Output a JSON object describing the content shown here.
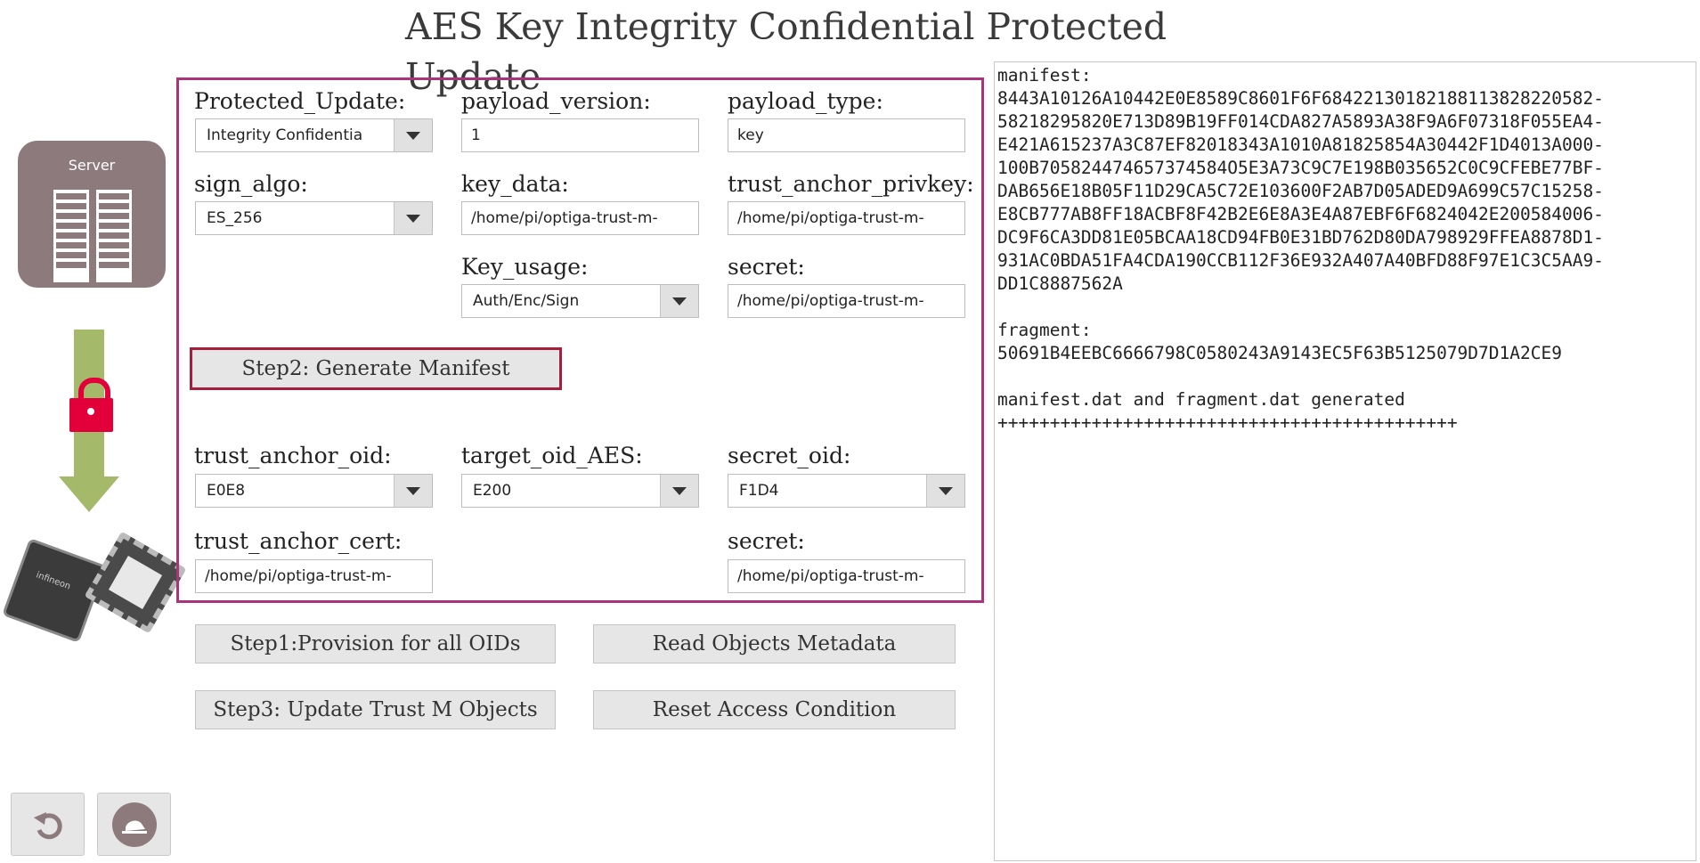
{
  "window_title": "AES Key Integrity Confidential Protected Update",
  "server_label": "Server",
  "chip_label": "infineon",
  "form": {
    "protected_update": {
      "label": "Protected_Update:",
      "value": "Integrity Confidentia"
    },
    "payload_version": {
      "label": "payload_version:",
      "value": "1"
    },
    "payload_type": {
      "label": "payload_type:",
      "value": "key"
    },
    "sign_algo": {
      "label": "sign_algo:",
      "value": "ES_256"
    },
    "key_data": {
      "label": "key_data:",
      "value": "/home/pi/optiga-trust-m-"
    },
    "trust_anchor_privkey": {
      "label": "trust_anchor_privkey:",
      "value": "/home/pi/optiga-trust-m-"
    },
    "key_usage": {
      "label": "Key_usage:",
      "value": "Auth/Enc/Sign"
    },
    "secret": {
      "label": "secret:",
      "value": "/home/pi/optiga-trust-m-"
    },
    "generate_manifest": "Step2: Generate Manifest",
    "trust_anchor_oid": {
      "label": "trust_anchor_oid:",
      "value": "E0E8"
    },
    "target_oid_aes": {
      "label": "target_oid_AES:",
      "value": "E200"
    },
    "secret_oid": {
      "label": "secret_oid:",
      "value": "F1D4"
    },
    "trust_anchor_cert": {
      "label": "trust_anchor_cert:",
      "value": "/home/pi/optiga-trust-m-"
    },
    "secret2": {
      "label": "secret:",
      "value": "/home/pi/optiga-trust-m-"
    }
  },
  "buttons": {
    "provision": "Step1:Provision for all OIDs",
    "read_metadata": "Read Objects Metadata",
    "update": "Step3: Update Trust M Objects",
    "reset": "Reset Access Condition"
  },
  "output": {
    "lines": [
      "manifest:",
      "8443A10126A10442E0E8589C8601F6F68422130182188113828220582-",
      "58218295820E713D89B19FF014CDA827A5893A38F9A6F07318F055EA4-",
      "E421A615237A3C87EF82018343A1010A81825854A30442F1D4013A000-",
      "100B705824474657374584O5E3A73C9C7E198B035652C0C9CFEBE77BF-",
      "DAB656E18B05F11D29CA5C72E103600F2AB7D05ADED9A699C57C15258-",
      "E8CB777AB8FF18ACBF8F42B2E6E8A3E4A87EBF6F6824042E200584006-",
      "DC9F6CA3DD81E05BCAA18CD94FB0E31BD762D80DA798929FFEA8878D1-",
      "931AC0BDA51FA4CDA190CCB112F36E932A407A40BFD88F97E1C3C5AA9-",
      "DD1C8887562A",
      "",
      "fragment:",
      "50691B4EEBC6666798C0580243A9143EC5F63B5125079D7D1A2CE9",
      "",
      "manifest.dat and fragment.dat generated",
      "++++++++++++++++++++++++++++++++++++++++++++"
    ]
  }
}
